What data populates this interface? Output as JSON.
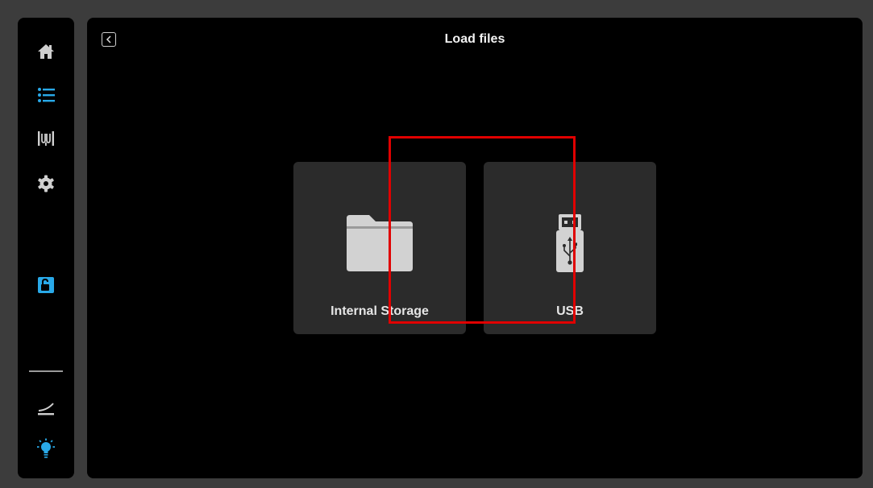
{
  "header": {
    "title": "Load files"
  },
  "sidebar": {
    "items": [
      {
        "name": "home",
        "icon": "home-icon"
      },
      {
        "name": "file-list",
        "icon": "list-icon",
        "active": true
      },
      {
        "name": "filament",
        "icon": "filament-icon"
      },
      {
        "name": "settings",
        "icon": "gear-icon"
      },
      {
        "name": "lock",
        "icon": "unlock-icon"
      },
      {
        "name": "bed-level",
        "icon": "bed-level-icon"
      },
      {
        "name": "light",
        "icon": "light-bulb-icon"
      }
    ],
    "colors": {
      "icon": "#c8c8c8",
      "active": "#29a9e8"
    }
  },
  "storage": [
    {
      "id": "internal",
      "label": "Internal Storage",
      "icon": "folder-icon"
    },
    {
      "id": "usb",
      "label": "USB",
      "icon": "usb-drive-icon",
      "highlighted": true
    }
  ],
  "colors": {
    "highlight": "#e00000",
    "tile": "#2b2b2b",
    "background": "#000000"
  }
}
